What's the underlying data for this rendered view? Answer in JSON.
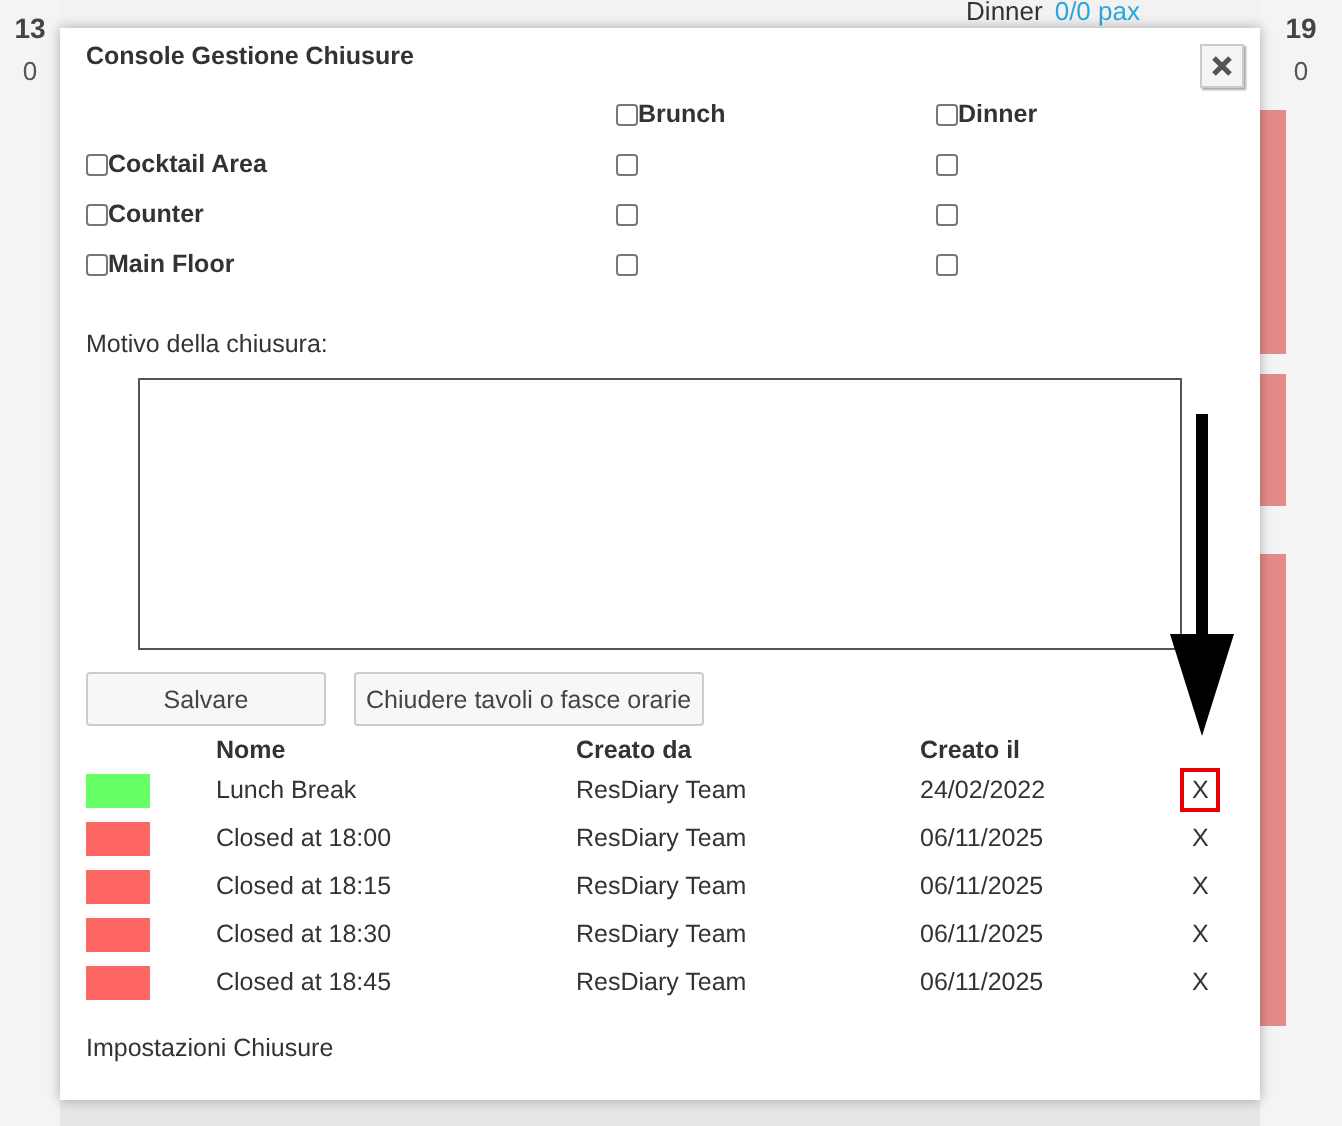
{
  "background": {
    "service": "Dinner",
    "pax": "0/0 pax",
    "left_day": "13",
    "left_count": "0",
    "right_day": "19",
    "right_count": "0"
  },
  "dialog": {
    "title": "Console Gestione Chiusure",
    "columns": [
      {
        "label": "Brunch",
        "checked": false
      },
      {
        "label": "Dinner",
        "checked": false
      }
    ],
    "areas": [
      {
        "label": "Cocktail Area",
        "checked": false,
        "cells": [
          {
            "checked": false
          },
          {
            "checked": false
          }
        ]
      },
      {
        "label": "Counter",
        "checked": false,
        "cells": [
          {
            "checked": false
          },
          {
            "checked": false
          }
        ]
      },
      {
        "label": "Main Floor",
        "checked": false,
        "cells": [
          {
            "checked": false
          },
          {
            "checked": false
          }
        ]
      }
    ],
    "reason_label": "Motivo della chiusura:",
    "buttons": [
      "Salvare",
      "Chiudere tavoli o fasce orarie"
    ],
    "table": {
      "columns": [
        "Nome",
        "Creato da",
        "Creato il"
      ],
      "rows": [
        {
          "color": "#66ff66",
          "name": "Lunch Break",
          "created_by": "ResDiary Team",
          "created_on": "24/02/2022",
          "delete": "X",
          "highlighted": true
        },
        {
          "color": "#ff6666",
          "name": "Closed at 18:00",
          "created_by": "ResDiary Team",
          "created_on": "06/11/2025",
          "delete": "X",
          "highlighted": false
        },
        {
          "color": "#ff6666",
          "name": "Closed at 18:15",
          "created_by": "ResDiary Team",
          "created_on": "06/11/2025",
          "delete": "X",
          "highlighted": false
        },
        {
          "color": "#ff6666",
          "name": "Closed at 18:30",
          "created_by": "ResDiary Team",
          "created_on": "06/11/2025",
          "delete": "X",
          "highlighted": false
        },
        {
          "color": "#ff6666",
          "name": "Closed at 18:45",
          "created_by": "ResDiary Team",
          "created_on": "06/11/2025",
          "delete": "X",
          "highlighted": false
        }
      ]
    },
    "footer": "Impostazioni Chiusure"
  }
}
